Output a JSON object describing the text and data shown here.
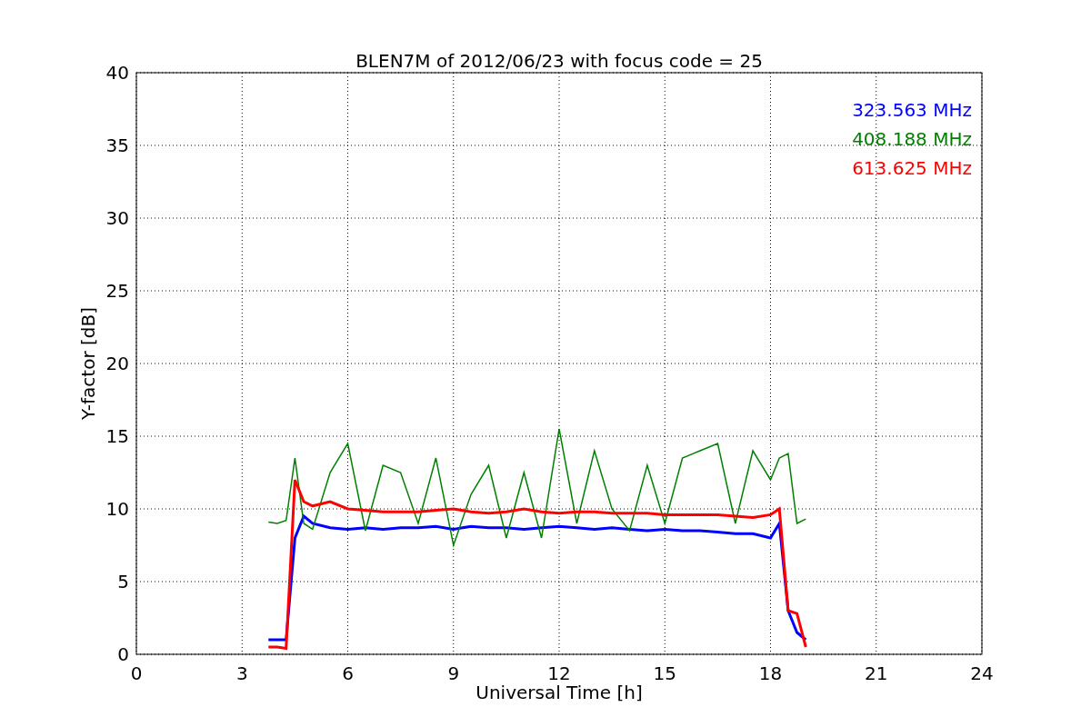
{
  "chart_data": {
    "type": "line",
    "title": "BLEN7M of 2012/06/23 with focus code = 25",
    "xlabel": "Universal Time [h]",
    "ylabel": "Y-factor [dB]",
    "x": [
      3.75,
      4,
      4.25,
      4.5,
      4.75,
      5,
      5.5,
      6,
      6.5,
      7,
      7.5,
      8,
      8.5,
      9,
      9.5,
      10,
      10.5,
      11,
      11.5,
      12,
      12.5,
      13,
      13.5,
      14,
      14.5,
      15,
      15.5,
      16,
      16.5,
      17,
      17.5,
      18,
      18.25,
      18.5,
      18.75,
      19
    ],
    "series": [
      {
        "name": "323.563 MHz",
        "color": "#0000ff",
        "values": [
          1,
          1,
          1,
          8,
          9.5,
          9,
          8.7,
          8.6,
          8.7,
          8.6,
          8.7,
          8.7,
          8.8,
          8.6,
          8.8,
          8.7,
          8.7,
          8.6,
          8.7,
          8.8,
          8.7,
          8.6,
          8.7,
          8.6,
          8.5,
          8.6,
          8.5,
          8.5,
          8.4,
          8.3,
          8.3,
          8.0,
          9.0,
          3.0,
          1.5,
          1.0
        ]
      },
      {
        "name": "408.188 MHz",
        "color": "#008000",
        "values": [
          9.1,
          9.0,
          9.2,
          13.5,
          9.0,
          8.6,
          12.5,
          14.5,
          8.5,
          13,
          12.5,
          9,
          13.5,
          7.5,
          11,
          13,
          8,
          12.5,
          8,
          15.5,
          9,
          14,
          10,
          8.5,
          13,
          9,
          13.5,
          14,
          14.5,
          9,
          14,
          12,
          13.5,
          13.8,
          9,
          9.3
        ]
      },
      {
        "name": "613.625 MHz",
        "color": "#ff0000",
        "values": [
          0.5,
          0.5,
          0.4,
          12,
          10.5,
          10.2,
          10.5,
          10.0,
          9.9,
          9.8,
          9.8,
          9.8,
          9.9,
          10.0,
          9.8,
          9.7,
          9.8,
          10.0,
          9.8,
          9.7,
          9.8,
          9.8,
          9.7,
          9.7,
          9.7,
          9.6,
          9.6,
          9.6,
          9.6,
          9.5,
          9.4,
          9.6,
          10.0,
          3.0,
          2.8,
          0.5
        ]
      }
    ],
    "grid": true,
    "xlim": [
      0,
      24
    ],
    "ylim": [
      0,
      40
    ],
    "xticks": [
      0,
      3,
      6,
      9,
      12,
      15,
      18,
      21,
      24
    ],
    "yticks": [
      0,
      5,
      10,
      15,
      20,
      25,
      30,
      35,
      40
    ]
  }
}
